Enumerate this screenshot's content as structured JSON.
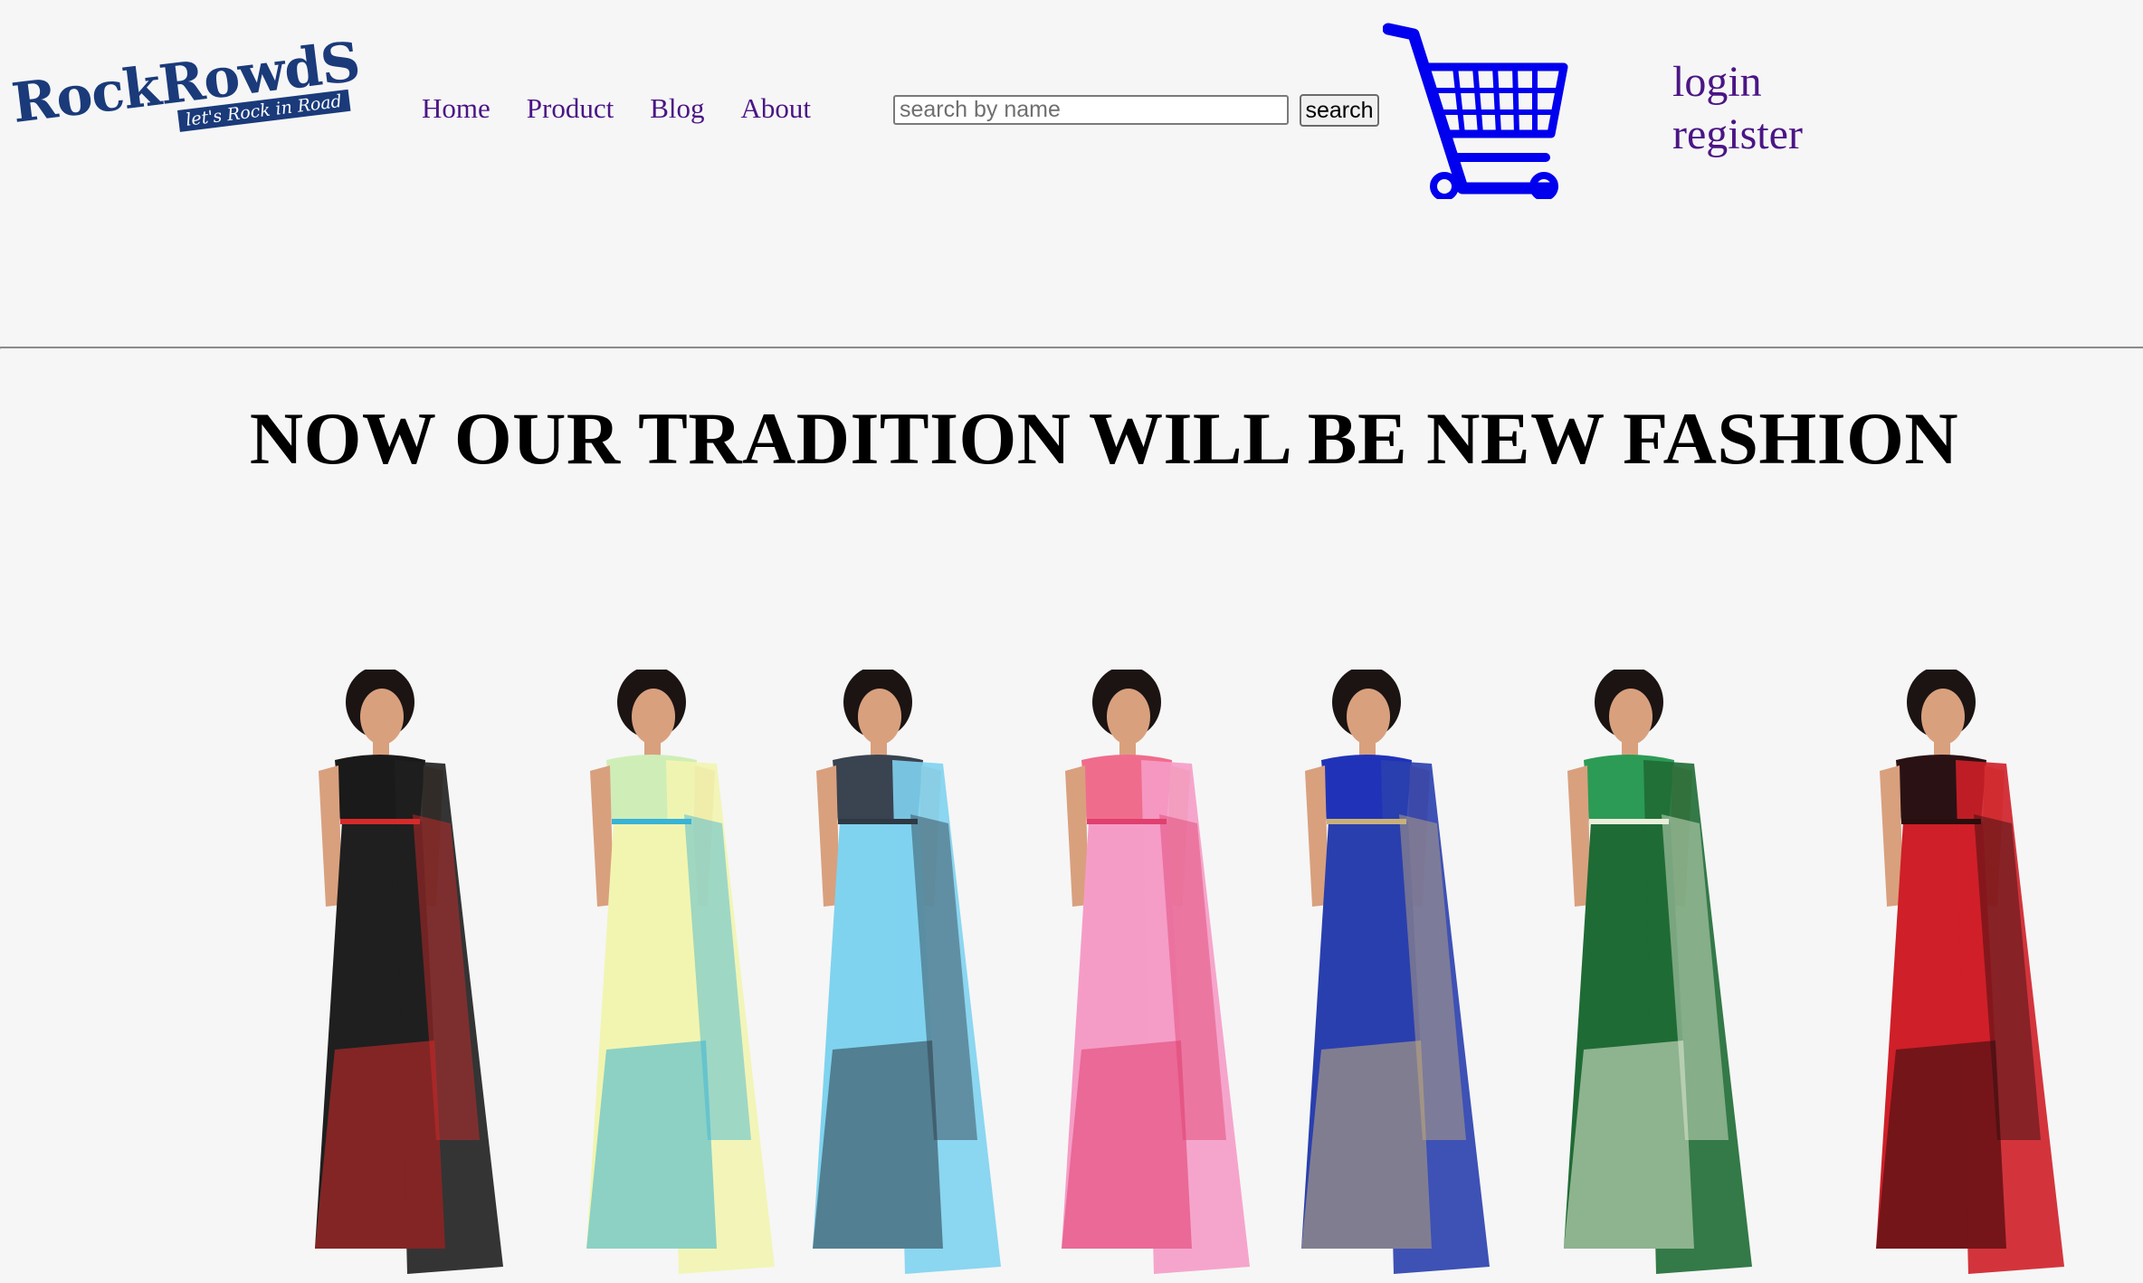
{
  "logo": {
    "name": "RockRowdS",
    "tagline": "let's Rock in Road"
  },
  "nav": {
    "items": [
      "Home",
      "Product",
      "Blog",
      "About"
    ]
  },
  "search": {
    "placeholder": "search by name",
    "button_label": "search"
  },
  "auth": {
    "login": "login",
    "register": "register"
  },
  "hero": {
    "title": "NOW OUR TRADITION WILL BE NEW FASHION"
  },
  "colors": {
    "link": "#4b1585",
    "cart": "#0000ee",
    "logo": "#1a3a7a"
  },
  "icons": {
    "cart": "shopping-cart-icon"
  },
  "gallery": {
    "items": [
      {
        "name": "black-saree",
        "drape": "#1f1f1f",
        "accent": "#d62a2a",
        "blouse": "#1a1a1a"
      },
      {
        "name": "yellow-saree",
        "drape": "#f2f5b0",
        "accent": "#39b3d6",
        "blouse": "#cfeeb7"
      },
      {
        "name": "sky-blue-saree",
        "drape": "#7fd3ef",
        "accent": "#2d3a44",
        "blouse": "#3a4350"
      },
      {
        "name": "pink-saree",
        "drape": "#f59cc6",
        "accent": "#e0406f",
        "blouse": "#f06c8c"
      },
      {
        "name": "blue-saree",
        "drape": "#2a3fae",
        "accent": "#c9b07a",
        "blouse": "#2033b8"
      },
      {
        "name": "green-saree",
        "drape": "#1f6b35",
        "accent": "#e9efd9",
        "blouse": "#2c9b55"
      },
      {
        "name": "red-saree",
        "drape": "#cf1f28",
        "accent": "#2a0d0d",
        "blouse": "#2a1214"
      }
    ]
  }
}
